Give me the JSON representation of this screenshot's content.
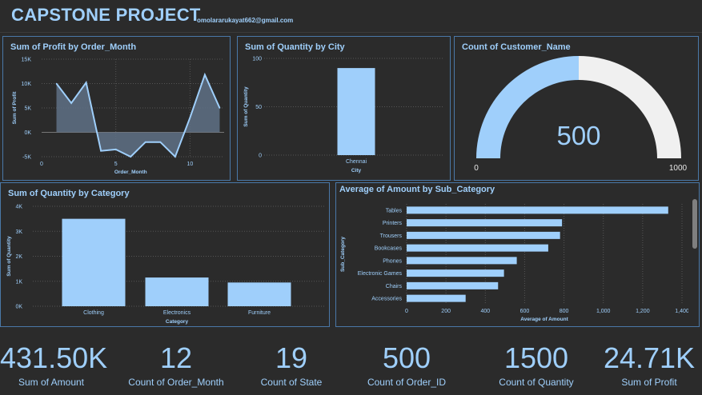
{
  "header": {
    "title": "CAPSTONE PROJECT",
    "email": "omolararukayat662@gmail.com"
  },
  "colors": {
    "background": "#2b2b2b",
    "accent": "#9fcffb",
    "border": "#4a78a8",
    "gauge_remainder": "#f0f0f0"
  },
  "gauge": {
    "title": "Count of Customer_Name",
    "value": 500,
    "value_label": "500",
    "min_label": "0",
    "max_label": "1000",
    "min": 0,
    "max": 1000
  },
  "chart_data": [
    {
      "type": "area",
      "title": "Sum of Profit by Order_Month",
      "xlabel": "Order_Month",
      "ylabel": "Sum of Profit",
      "x": [
        1,
        2,
        3,
        4,
        5,
        6,
        7,
        8,
        9,
        10,
        11,
        12
      ],
      "values": [
        10000,
        6000,
        10200,
        -3800,
        -3500,
        -5000,
        -2000,
        -2000,
        -5000,
        3000,
        11800,
        5000
      ],
      "xticks": [
        "0",
        "5",
        "10"
      ],
      "xtick_values": [
        0,
        5,
        10
      ],
      "yticks": [
        "-5K",
        "0K",
        "5K",
        "10K",
        "15K"
      ],
      "ytick_values": [
        -5000,
        0,
        5000,
        10000,
        15000
      ],
      "xlim": [
        0,
        12.3
      ],
      "ylim": [
        -5000,
        15000
      ]
    },
    {
      "type": "bar",
      "title": "Sum of Quantity by City",
      "xlabel": "City",
      "ylabel": "Sum of Quantity",
      "categories": [
        "Chennai"
      ],
      "values": [
        90
      ],
      "yticks": [
        "0",
        "50",
        "100"
      ],
      "ytick_values": [
        0,
        50,
        100
      ],
      "ylim": [
        0,
        100
      ]
    },
    {
      "type": "bar",
      "title": "Sum of Quantity by Category",
      "xlabel": "Category",
      "ylabel": "Sum of Quantity",
      "categories": [
        "Clothing",
        "Electronics",
        "Furniture"
      ],
      "values": [
        3500,
        1150,
        950
      ],
      "yticks": [
        "0K",
        "1K",
        "2K",
        "3K",
        "4K"
      ],
      "ytick_values": [
        0,
        1000,
        2000,
        3000,
        4000
      ],
      "ylim": [
        0,
        4000
      ]
    },
    {
      "type": "bar",
      "orientation": "horizontal",
      "title": "Average of Amount by Sub_Category",
      "xlabel": "Average of Amount",
      "ylabel": "Sub_Category",
      "categories": [
        "Tables",
        "Printers",
        "Trousers",
        "Bookcases",
        "Phones",
        "Electronic Games",
        "Chairs",
        "Accessories"
      ],
      "values": [
        1330,
        790,
        780,
        720,
        560,
        495,
        465,
        300
      ],
      "xticks": [
        "0",
        "200",
        "400",
        "600",
        "800",
        "1,000",
        "1,200",
        "1,400"
      ],
      "xtick_values": [
        0,
        200,
        400,
        600,
        800,
        1000,
        1200,
        1400
      ],
      "xlim": [
        0,
        1400
      ]
    }
  ],
  "kpis": [
    {
      "value": "431.50K",
      "label": "Sum of Amount"
    },
    {
      "value": "12",
      "label": "Count of Order_Month"
    },
    {
      "value": "19",
      "label": "Count of State"
    },
    {
      "value": "500",
      "label": "Count of Order_ID"
    },
    {
      "value": "1500",
      "label": "Count of Quantity"
    },
    {
      "value": "24.71K",
      "label": "Sum of Profit"
    }
  ]
}
